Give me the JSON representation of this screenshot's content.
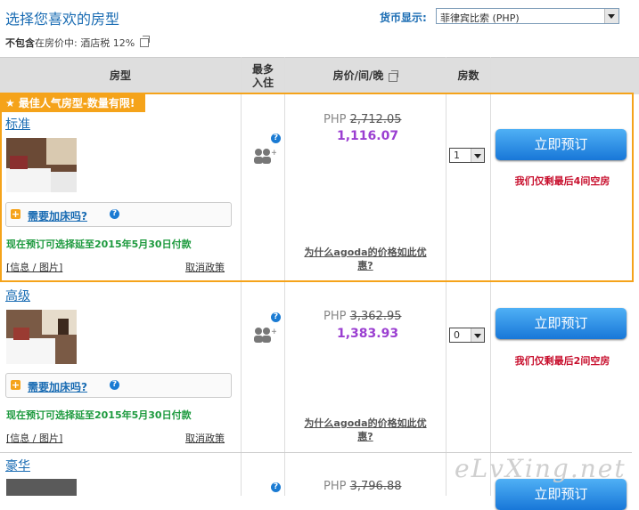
{
  "header": {
    "title": "选择您喜欢的房型",
    "excl_label": "不包含",
    "excl_text": "在房价中: 酒店税 12%",
    "currency_label": "货币显示:",
    "currency_value": "菲律宾比索 (PHP)"
  },
  "columns": {
    "room_type": "房型",
    "max_guests_1": "最多",
    "max_guests_2": "入住",
    "price": "房价/间/晚",
    "rooms": "房数"
  },
  "badge": "★ 最佳人气房型-数量有限!",
  "rooms": [
    {
      "name": "标准",
      "extra_bed": "需要加床吗?",
      "pay_by": "现在预订可选择延至2015年5月30日付款",
      "info": "[信息 / 图片]",
      "cancel": "取消政策",
      "currency": "PHP",
      "old_price": "2,712.05",
      "new_price": "1,116.07",
      "why": "为什么agoda的价格如此优惠?",
      "qty": "1",
      "book": "立即预订",
      "last": "我们仅剩最后4间空房"
    },
    {
      "name": "高级",
      "extra_bed": "需要加床吗?",
      "pay_by": "现在预订可选择延至2015年5月30日付款",
      "info": "[信息 / 图片]",
      "cancel": "取消政策",
      "currency": "PHP",
      "old_price": "3,362.95",
      "new_price": "1,383.93",
      "why": "为什么agoda的价格如此优惠?",
      "qty": "0",
      "book": "立即预订",
      "last": "我们仅剩最后2间空房"
    },
    {
      "name": "豪华",
      "currency": "PHP",
      "old_price": "3,796.88",
      "book": "立即预订"
    }
  ],
  "watermark": "eLvXing.net",
  "colors": {
    "accent": "#1a6cb3",
    "highlight": "#f5a31a",
    "price": "#9b3fd1",
    "alert": "#c8102e",
    "pay": "#1d9a3e"
  }
}
